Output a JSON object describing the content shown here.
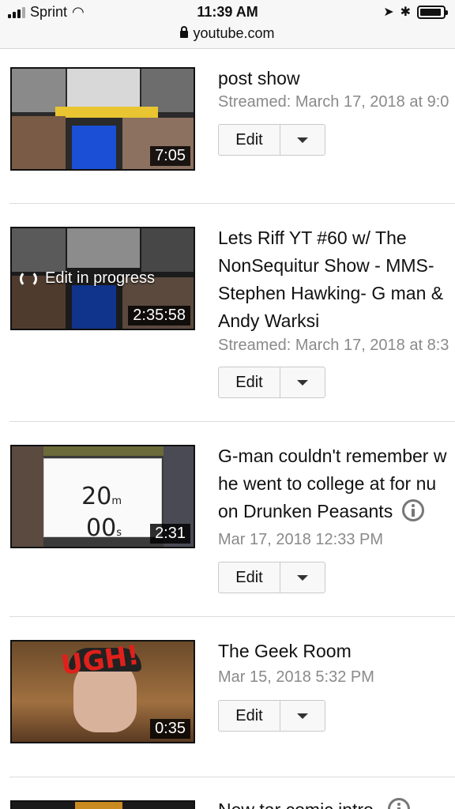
{
  "status_bar": {
    "carrier": "Sprint",
    "time": "11:39 AM",
    "url": "youtube.com"
  },
  "videos": [
    {
      "title_lines": [
        "post show"
      ],
      "meta": "Streamed: March 17, 2018 at 9:0",
      "duration": "7:05",
      "edit_label": "Edit",
      "has_info": false
    },
    {
      "title_lines": [
        "Lets Riff YT #60 w/ The",
        "NonSequitur Show - MMS-",
        "Stephen Hawking- G man &",
        "Andy Warksi"
      ],
      "meta": "Streamed: March 17, 2018 at 8:3",
      "duration": "2:35:58",
      "overlay_label": "Edit in progress",
      "edit_label": "Edit",
      "has_info": false
    },
    {
      "title_lines": [
        "G-man couldn't remember w",
        "he went to college at for nu",
        "on Drunken Peasants"
      ],
      "meta": "Mar 17, 2018 12:33 PM",
      "duration": "2:31",
      "timer_top": "20",
      "timer_top_unit": "m",
      "timer_bottom": "00",
      "timer_bottom_unit": "s",
      "edit_label": "Edit",
      "has_info": true
    },
    {
      "title_lines": [
        "The Geek Room"
      ],
      "meta": "Mar 15, 2018 5:32 PM",
      "duration": "0:35",
      "thumb_text": "UGH!",
      "edit_label": "Edit",
      "has_info": false
    },
    {
      "title_lines": [
        "New tar comic intro"
      ],
      "has_info": true
    }
  ]
}
